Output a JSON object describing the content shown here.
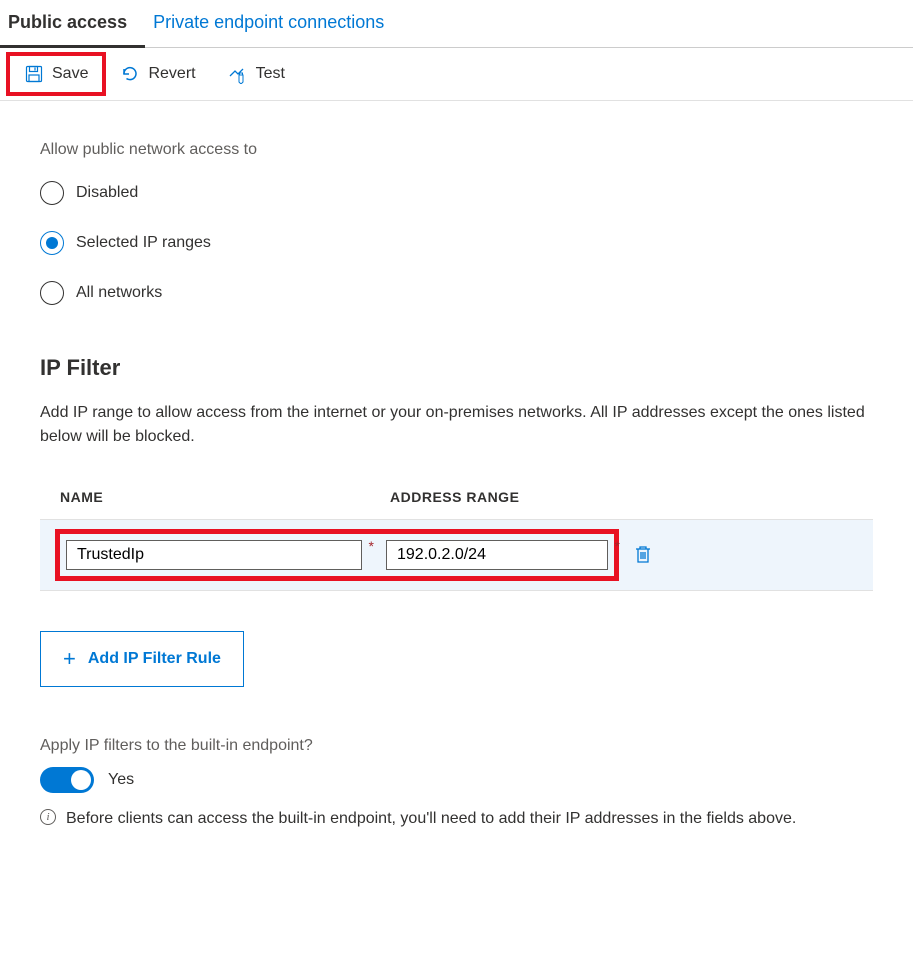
{
  "tabs": {
    "public": "Public access",
    "private": "Private endpoint connections"
  },
  "toolbar": {
    "save": "Save",
    "revert": "Revert",
    "test": "Test"
  },
  "access": {
    "label": "Allow public network access to",
    "options": {
      "disabled": "Disabled",
      "selected": "Selected IP ranges",
      "all": "All networks"
    }
  },
  "ipfilter": {
    "title": "IP Filter",
    "desc": "Add IP range to allow access from the internet or your on-premises networks. All IP addresses except the ones listed below will be blocked.",
    "col_name": "NAME",
    "col_addr": "ADDRESS RANGE",
    "rows": [
      {
        "name": "TrustedIp",
        "addr": "192.0.2.0/24"
      }
    ],
    "add_btn": "Add IP Filter Rule"
  },
  "apply": {
    "label": "Apply IP filters to the built-in endpoint?",
    "toggle_text": "Yes",
    "info": "Before clients can access the built-in endpoint, you'll need to add their IP addresses in the fields above."
  }
}
